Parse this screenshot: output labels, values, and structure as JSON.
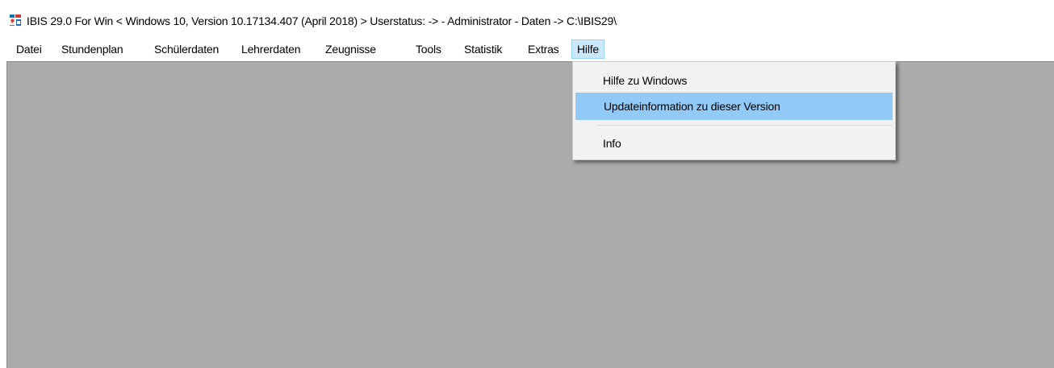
{
  "window": {
    "title": "IBIS 29.0 For Win   < Windows 10, Version 10.17134.407 (April 2018) >   Userstatus: ->  - Administrator -  Daten -> C:\\IBIS29\\"
  },
  "menubar": {
    "items": [
      {
        "label": "Datei"
      },
      {
        "label": "Stundenplan"
      },
      {
        "label": "Schülerdaten"
      },
      {
        "label": "Lehrerdaten"
      },
      {
        "label": "Zeugnisse"
      },
      {
        "label": "Tools"
      },
      {
        "label": "Statistik"
      },
      {
        "label": "Extras"
      },
      {
        "label": "Hilfe",
        "active": true
      }
    ]
  },
  "dropdown": {
    "items": [
      {
        "label": "Hilfe zu Windows"
      },
      {
        "label": "Updateinformation zu dieser Version",
        "highlighted": true
      },
      {
        "label": "Info"
      }
    ]
  },
  "colors": {
    "client_background": "#ababab",
    "menu_active": "#cce8ff",
    "dropdown_highlight": "#91c9f7"
  },
  "icons": {
    "app": "ibis-app-icon"
  }
}
